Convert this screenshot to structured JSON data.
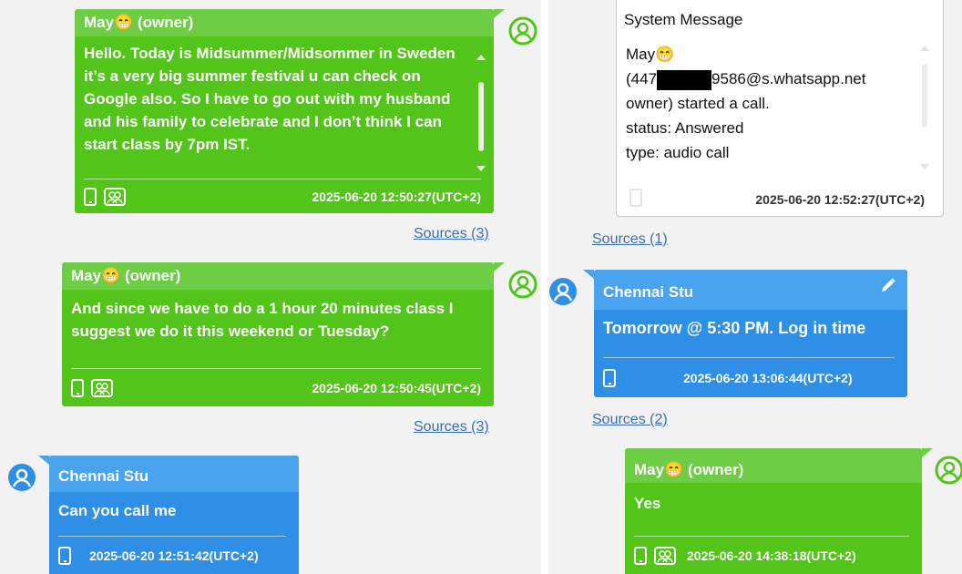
{
  "left_column": {
    "msg1": {
      "sender": "May😁 (owner)",
      "text": "Hello. Today is Midsummer/Midsommer in Sweden it’s a very big summer festival u can check on Google also. So I have to go out with my husband and his family to celebrate and I don’t think I can start class by 7pm IST.",
      "timestamp": "2025-06-20 12:50:27(UTC+2)",
      "sources": "Sources (3)"
    },
    "msg2": {
      "sender": "May😁 (owner)",
      "text": "And since we have to do a 1 hour 20 minutes class I suggest we do it this weekend or Tuesday?",
      "timestamp": "2025-06-20 12:50:45(UTC+2)",
      "sources": "Sources (3)"
    },
    "msg3": {
      "sender": "Chennai Stu",
      "text": "Can you call me",
      "timestamp": "2025-06-20 12:51:42(UTC+2)"
    }
  },
  "right_column": {
    "system": {
      "title": "System Message",
      "line1": "May😁",
      "line2_prefix": "(447",
      "line2_suffix": "9586@s.whatsapp.net",
      "line3": "owner) started a call.",
      "line4": "status: Answered",
      "line5": "type: audio call",
      "timestamp": "2025-06-20 12:52:27(UTC+2)",
      "sources": "Sources (1)"
    },
    "msg4": {
      "sender": "Chennai Stu",
      "text": "Tomorrow @ 5:30 PM. Log in time",
      "timestamp": "2025-06-20 13:06:44(UTC+2)",
      "sources": "Sources (2)"
    },
    "msg5": {
      "sender": "May😁 (owner)",
      "text": "Yes",
      "timestamp": "2025-06-20 14:38:18(UTC+2)"
    }
  },
  "colors": {
    "owner_bubble": "#52c41a",
    "owner_header": "#6dcd44",
    "contact_bubble": "#2f8fe6",
    "contact_header": "#4aa3ee",
    "link": "#3a6fb4"
  },
  "icons": [
    "user-avatar-icon",
    "phone-icon",
    "group-icon",
    "edit-pencil-icon",
    "scrollbar-arrow-icon"
  ]
}
